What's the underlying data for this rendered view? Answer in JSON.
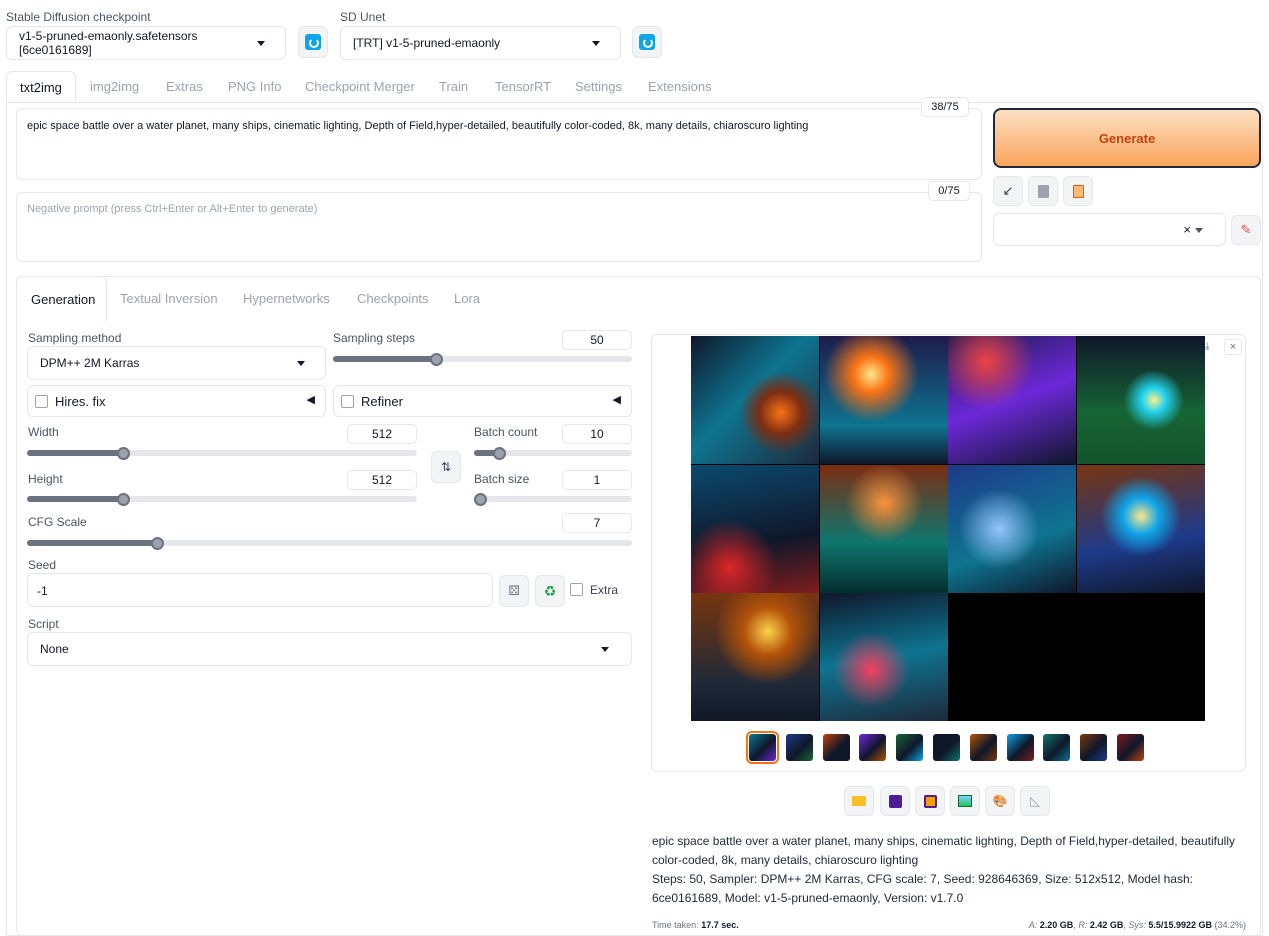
{
  "checkpoint": {
    "label": "Stable Diffusion checkpoint",
    "value": "v1-5-pruned-emaonly.safetensors [6ce0161689]"
  },
  "unet": {
    "label": "SD Unet",
    "value": "[TRT] v1-5-pruned-emaonly"
  },
  "tabs": [
    "txt2img",
    "img2img",
    "Extras",
    "PNG Info",
    "Checkpoint Merger",
    "Train",
    "TensorRT",
    "Settings",
    "Extensions"
  ],
  "prompt": {
    "text": "epic space battle over a water planet, many ships, cinematic lighting, Depth of Field,hyper-detailed, beautifully color-coded, 8k, many details, chiaroscuro lighting",
    "counter": "38/75"
  },
  "negative": {
    "placeholder": "Negative prompt (press Ctrl+Enter or Alt+Enter to generate)",
    "counter": "0/75"
  },
  "generate_label": "Generate",
  "subtabs": [
    "Generation",
    "Textual Inversion",
    "Hypernetworks",
    "Checkpoints",
    "Lora"
  ],
  "sampling": {
    "method_label": "Sampling method",
    "method": "DPM++ 2M Karras",
    "steps_label": "Sampling steps",
    "steps": "50",
    "steps_frac": 0.34
  },
  "hires_label": "Hires. fix",
  "refiner_label": "Refiner",
  "width": {
    "label": "Width",
    "value": "512",
    "frac": 0.24
  },
  "height": {
    "label": "Height",
    "value": "512",
    "frac": 0.24
  },
  "batch_count": {
    "label": "Batch count",
    "value": "10",
    "frac": 0.13
  },
  "batch_size": {
    "label": "Batch size",
    "value": "1",
    "frac": 0.0
  },
  "cfg": {
    "label": "CFG Scale",
    "value": "7",
    "frac": 0.21
  },
  "seed": {
    "label": "Seed",
    "value": "-1",
    "extra_label": "Extra"
  },
  "script": {
    "label": "Script",
    "value": "None"
  },
  "output": {
    "caption": "epic space battle over a water planet, many ships, cinematic lighting, Depth of Field,hyper-detailed, beautifully color-coded, 8k, many details, chiaroscuro lighting",
    "params": "Steps: 50, Sampler: DPM++ 2M Karras, CFG scale: 7, Seed: 928646369, Size: 512x512, Model hash: 6ce0161689, Model: v1-5-pruned-emaonly, Version: v1.7.0",
    "time_label": "Time taken:",
    "time_value": "17.7 sec.",
    "mem_a_label": "A:",
    "mem_a": "2.20 GB",
    "mem_r_label": "R:",
    "mem_r": "2.42 GB",
    "mem_sys_label": "Sys:",
    "mem_sys": "5.5/15.9922 GB",
    "mem_pct": "(34.2%)"
  },
  "thumbnail_count": 11,
  "colors": {
    "generate_from": "#fde0c4",
    "generate_to": "#f9a55b",
    "generate_text": "#c2410c",
    "accent": "#f97316"
  }
}
